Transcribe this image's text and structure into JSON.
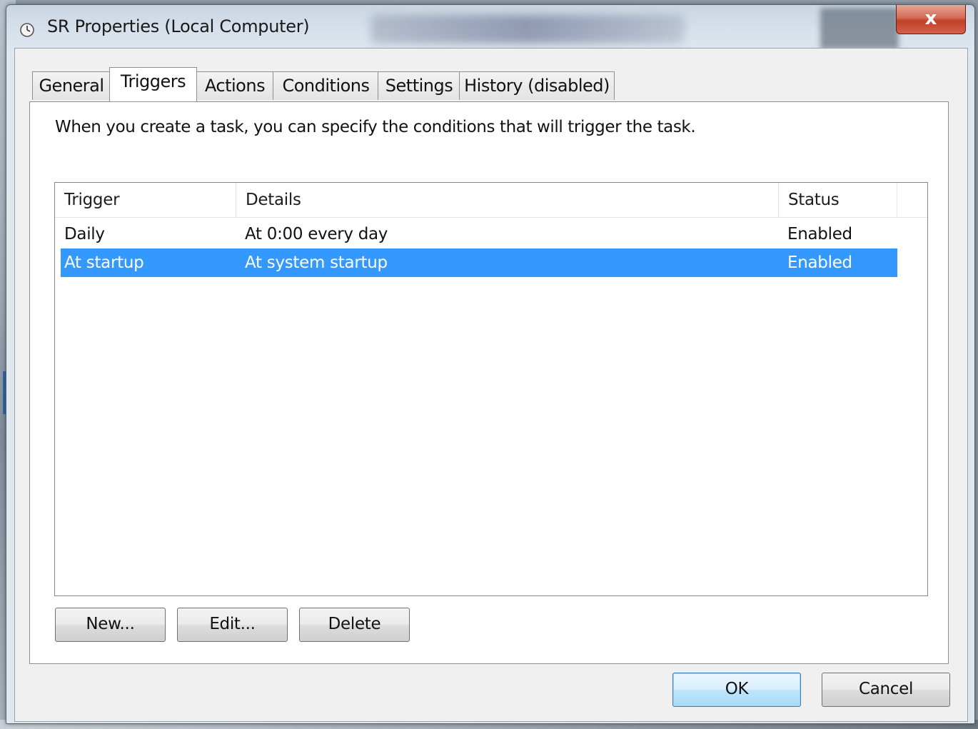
{
  "window": {
    "title": "SR Properties (Local Computer)",
    "close_label": "x",
    "icon": "clock-icon"
  },
  "tabs": [
    {
      "label": "General",
      "active": false
    },
    {
      "label": "Triggers",
      "active": true
    },
    {
      "label": "Actions",
      "active": false
    },
    {
      "label": "Conditions",
      "active": false
    },
    {
      "label": "Settings",
      "active": false
    },
    {
      "label": "History (disabled)",
      "active": false
    }
  ],
  "triggers_page": {
    "description": "When you create a task, you can specify the conditions that will trigger the task.",
    "columns": [
      "Trigger",
      "Details",
      "Status"
    ],
    "rows": [
      {
        "trigger": "Daily",
        "details": "At 0:00 every day",
        "status": "Enabled",
        "selected": false
      },
      {
        "trigger": "At startup",
        "details": "At system startup",
        "status": "Enabled",
        "selected": true
      }
    ],
    "buttons": {
      "new": "New...",
      "edit": "Edit...",
      "delete": "Delete"
    }
  },
  "dialog_buttons": {
    "ok": "OK",
    "cancel": "Cancel"
  },
  "colors": {
    "selection": "#3399ff",
    "close_button": "#c0402a"
  }
}
